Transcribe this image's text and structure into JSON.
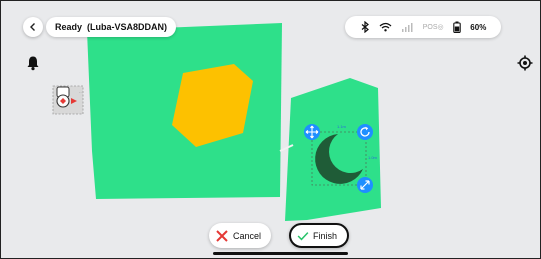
{
  "status": {
    "title": "Ready",
    "device": "(Luba-VSA8DDAN)"
  },
  "system": {
    "icons": [
      "bluetooth-icon",
      "wifi-icon",
      "cellular-icon",
      "pos-signal-icon",
      "battery-icon"
    ],
    "pos_label": "POS",
    "battery_percent": "60%"
  },
  "actions": {
    "cancel_label": "Cancel",
    "finish_label": "Finish"
  },
  "colors": {
    "zone": "#2ee08a",
    "obstacle": "#fdc100",
    "moon_obstacle": "#1f5c37",
    "handle": "#1f8fff",
    "cancel_x": "#e53935",
    "finish_check": "#27c36a",
    "background": "#e9eaec"
  }
}
